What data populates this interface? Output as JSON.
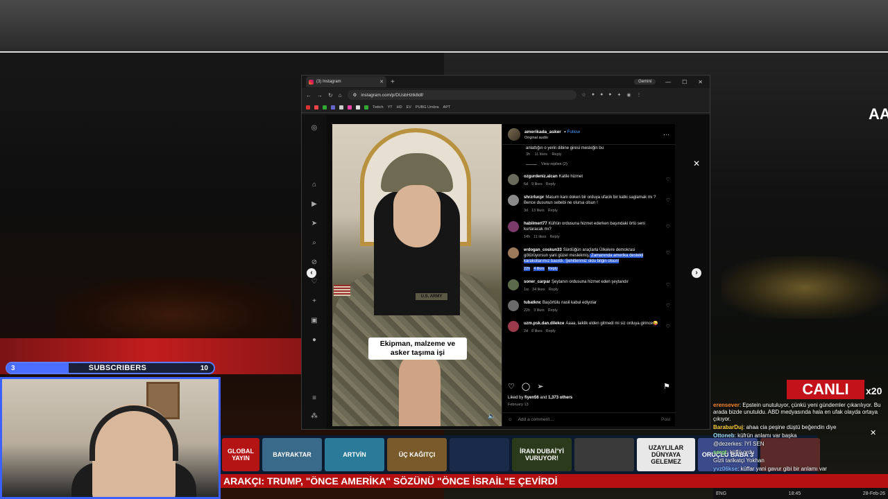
{
  "stream": {
    "subscribers": {
      "label": "SUBSCRIBERS",
      "current": "3",
      "goal": "10",
      "progress": 0.3
    },
    "canli": "CANLI",
    "multiplier": "x20",
    "ticker": "ARAKÇI: TRUMP, \"ÖNCE AMERİKA\" SÖZÜNÜ \"ÖNCE İSRAİL\"E ÇEVİRDİ",
    "thumbs": [
      {
        "text": "GLOBAL YAYIN",
        "color": "#b41414"
      },
      {
        "text": "BAYRAKTAR",
        "color": "#3a6a8a"
      },
      {
        "text": "ARTVİN",
        "color": "#2a7a9a"
      },
      {
        "text": "ÜÇ KAĞITÇI",
        "color": "#7a5a2a"
      },
      {
        "text": "",
        "color": "#1a2a4a"
      },
      {
        "text": "İRAN DUBAİ'Yİ VURUYOR!",
        "color": "#2a3a1a"
      },
      {
        "text": "",
        "color": "#3a3a3a"
      },
      {
        "text": "UZAYLILAR DÜNYAYA GELEMEZ",
        "color": "#e8e8e8"
      },
      {
        "text": "ORUÇLU BABA 3",
        "color": "#3a4a8a"
      },
      {
        "text": "",
        "color": "#5a2a2a"
      }
    ],
    "chat": [
      {
        "user": "erensever",
        "text": ": Epstein unutuluyor, çünkü yeni gündemler çıkarılıyor. Bu arada bizde unutuldu. ABD medyasında hala en ufak olayda ortaya çıkıyor.",
        "color": "#ff8a2a"
      },
      {
        "user": "BarabarDuj",
        "text": ": ahaa cia peşine düştü beğendin diye",
        "color": "#ffd23a"
      },
      {
        "user": "Ottoneb",
        "text": ": küfrün anlamı var başka",
        "color": "#a0e0ff"
      },
      {
        "user": "",
        "text": "@dezerkes: İYİ SEN",
        "color": "#ffffff"
      },
      {
        "user": "sergt",
        "text": ": küflü ordu",
        "color": "#9aff9a"
      },
      {
        "user": "",
        "text": "Gizli tarikatçi Yokhan",
        "color": "#ffffff"
      },
      {
        "user": "yvz06kse",
        "text": ": küffar yani gavur gibi bir anlamı var",
        "color": "#7ab0ff"
      }
    ],
    "taskbar": {
      "lang": "ENG",
      "time": "18:45",
      "date": "28-Feb-26"
    }
  },
  "browser": {
    "tab_title": "(3) Instagram",
    "gemini": "Gemini",
    "url": "instagram.com/p/DUsbHztk8df/",
    "bookmarks": [
      "Twitch",
      "YT",
      "HD",
      "EV",
      "PUBG Umbra",
      "APT"
    ]
  },
  "post": {
    "username": "amerikada_asker",
    "follow": "Follow",
    "audio": "Original audio",
    "caption_overlay": "Ekipman, malzeme ve asker taşıma işi",
    "tape": "U.S. ARMY",
    "top_comment": {
      "text": "anlattığın o yerin dibine giresi mesleğin bu",
      "time": "3h",
      "likes": "11 likes",
      "reply": "Reply"
    },
    "view_replies": "View replies (2)",
    "comments": [
      {
        "user": "ozgurdeniz.alcan",
        "text": "Katile hizmet",
        "time": "6d",
        "likes": "9 likes",
        "reply": "Reply",
        "av": "#6a6a5a"
      },
      {
        "user": "shrzrlucpr",
        "text": "Masum kani doken bir orduya ufacik bir katki saglamak mı ? Bence dusunun sebebi ne olursa olsun !",
        "time": "3d",
        "likes": "13 likes",
        "reply": "Reply",
        "av": "#8a8a8a"
      },
      {
        "user": "habilmert77",
        "text": "Küfrün ordusuna hizmet ederken başındaki örtü seni kurtaracak mı?",
        "time": "14h",
        "likes": "11 likes",
        "reply": "Reply",
        "av": "#7a3a6a"
      },
      {
        "user": "erdogan_coskun33",
        "text": "Sürdüğün araçlarla Ülkelere demokrasi götürüyorsun yani güzel meslekmiş.",
        "text_hl": " Zamanında amerika destekli karakollarımız basıldı. Şehitlerimiz oldu bilgin olsun!",
        "time": "22h",
        "likes": "4 likes",
        "reply": "Reply",
        "av": "#9a7a5a"
      },
      {
        "user": "soner_carpar",
        "text": "Şeytanın ordusuna hizmet eden şeytandır",
        "time": "1w",
        "likes": "34 likes",
        "reply": "Reply",
        "av": "#5a6a4a"
      },
      {
        "user": "tubatknc",
        "text": "Başörtülu nasil kabul ediyolar",
        "time": "22h",
        "likes": "3 likes",
        "reply": "Reply",
        "av": "#6a6a6a"
      },
      {
        "user": "uzm.psk.dan.dilekce",
        "text": "Aaaa, laiklik elden gitmedi mi siz orduya girince😜",
        "time": "2d",
        "likes": "8 likes",
        "reply": "Reply",
        "av": "#9a3a4a"
      }
    ],
    "liked_by": {
      "prefix": "Liked by",
      "user": "fiyen56",
      "mid": "and",
      "others": "1,373 others"
    },
    "date": "February 13",
    "add_comment_placeholder": "Add a comment…",
    "post_label": "Post"
  }
}
